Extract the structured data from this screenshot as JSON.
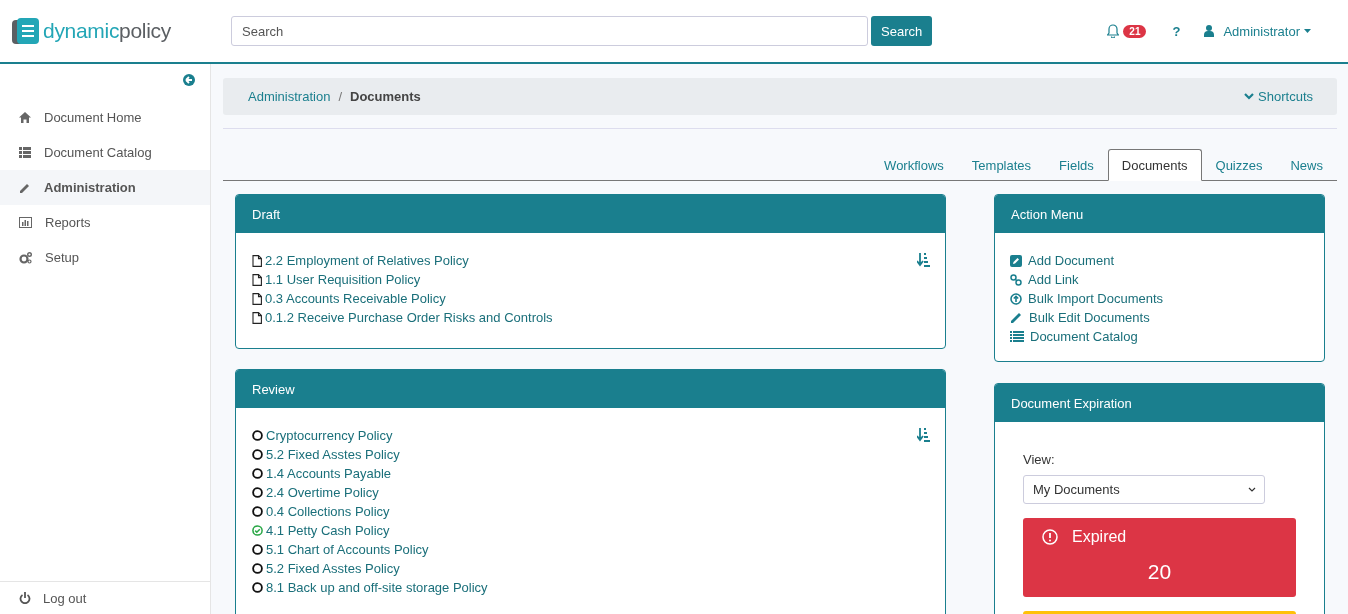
{
  "header": {
    "logo": {
      "first": "dynamic",
      "second": "policy"
    },
    "search": {
      "placeholder": "Search",
      "button": "Search"
    },
    "notifications": {
      "count": "21"
    },
    "help": "?",
    "user": "Administrator"
  },
  "sidebar": {
    "items": [
      {
        "label": "Document Home",
        "selected": false
      },
      {
        "label": "Document Catalog",
        "selected": false
      },
      {
        "label": "Administration",
        "selected": true
      },
      {
        "label": "Reports",
        "selected": false
      },
      {
        "label": "Setup",
        "selected": false
      }
    ],
    "logout": "Log out"
  },
  "breadcrumb": {
    "items": [
      "Administration",
      "Documents"
    ],
    "separator": "/",
    "shortcuts": "Shortcuts"
  },
  "tabs": [
    {
      "label": "Workflows",
      "selected": false
    },
    {
      "label": "Templates",
      "selected": false
    },
    {
      "label": "Fields",
      "selected": false
    },
    {
      "label": "Documents",
      "selected": true
    },
    {
      "label": "Quizzes",
      "selected": false
    },
    {
      "label": "News",
      "selected": false
    }
  ],
  "draft": {
    "title": "Draft",
    "items": [
      "2.2 Employment of Relatives Policy",
      "1.1 User Requisition Policy",
      "0.3 Accounts Receivable Policy",
      "0.1.2 Receive Purchase Order Risks and Controls"
    ]
  },
  "review": {
    "title": "Review",
    "items": [
      {
        "label": "Cryptocurrency Policy",
        "approved": false
      },
      {
        "label": "5.2 Fixed Asstes Policy",
        "approved": false
      },
      {
        "label": "1.4 Accounts Payable",
        "approved": false
      },
      {
        "label": "2.4 Overtime Policy",
        "approved": false
      },
      {
        "label": "0.4 Collections Policy",
        "approved": false
      },
      {
        "label": "4.1 Petty Cash Policy",
        "approved": true
      },
      {
        "label": "5.1 Chart of Accounts Policy",
        "approved": false
      },
      {
        "label": "5.2 Fixed Asstes Policy",
        "approved": false
      },
      {
        "label": "8.1 Back up and off-site storage Policy",
        "approved": false
      }
    ]
  },
  "action_menu": {
    "title": "Action Menu",
    "items": [
      "Add Document",
      "Add Link",
      "Bulk Import Documents",
      "Bulk Edit Documents",
      "Document Catalog"
    ]
  },
  "expiration": {
    "title": "Document Expiration",
    "view_label": "View:",
    "view_value": "My Documents",
    "expired": {
      "label": "Expired",
      "count": "20"
    }
  }
}
